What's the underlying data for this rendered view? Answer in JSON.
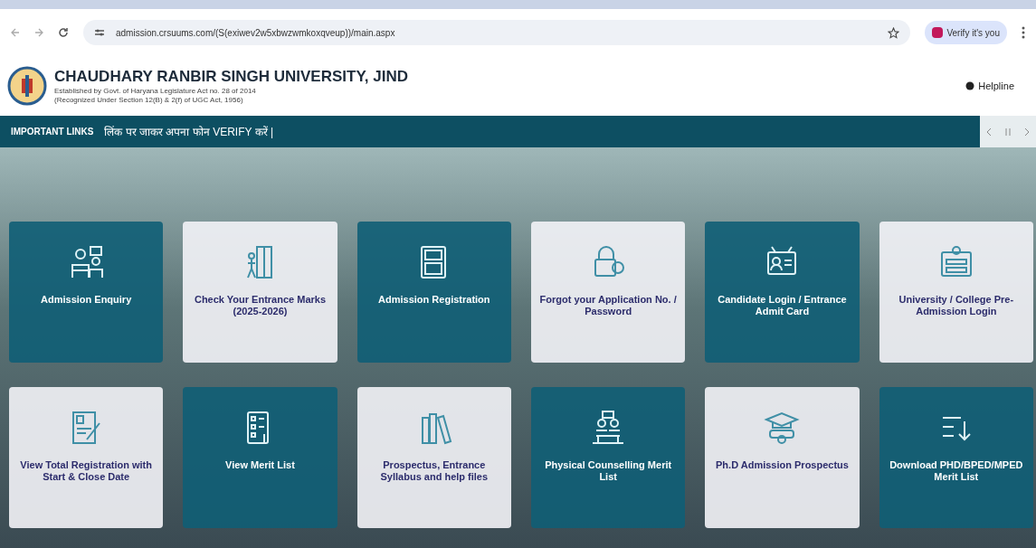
{
  "browser": {
    "url": "admission.crsuums.com/(S(exiwev2w5xbwzwmkoxqveup))/main.aspx",
    "profile_chip": "Verify it's you"
  },
  "header": {
    "title": "CHAUDHARY RANBIR SINGH UNIVERSITY, JIND",
    "subtitle_lines": [
      "Established by Govt. of Haryana Legislature Act no. 28 of 2014",
      "(Recognized Under Section 12(B) & 2(f) of UGC Act, 1956)"
    ],
    "helpline": "Helpline"
  },
  "ticker": {
    "label": "IMPORTANT LINKS",
    "message": "लिंक पर जाकर अपना फोन VERIFY करें |"
  },
  "tiles": [
    {
      "label": "Admission Enquiry",
      "kind": "dark"
    },
    {
      "label": "Check Your Entrance Marks (2025-2026)",
      "kind": "light"
    },
    {
      "label": "Admission Registration",
      "kind": "dark"
    },
    {
      "label": "Forgot your Application No. / Password",
      "kind": "light"
    },
    {
      "label": "Candidate Login / Entrance Admit Card",
      "kind": "dark"
    },
    {
      "label": "University / College Pre-Admission Login",
      "kind": "light"
    },
    {
      "label": "View Total Registration with Start & Close Date",
      "kind": "light"
    },
    {
      "label": "View Merit List",
      "kind": "dark"
    },
    {
      "label": "Prospectus, Entrance Syllabus and help files",
      "kind": "light"
    },
    {
      "label": "Physical Counselling Merit List",
      "kind": "dark"
    },
    {
      "label": "Ph.D Admission Prospectus",
      "kind": "light"
    },
    {
      "label": "Download PHD/BPED/MPED Merit List",
      "kind": "dark"
    }
  ]
}
